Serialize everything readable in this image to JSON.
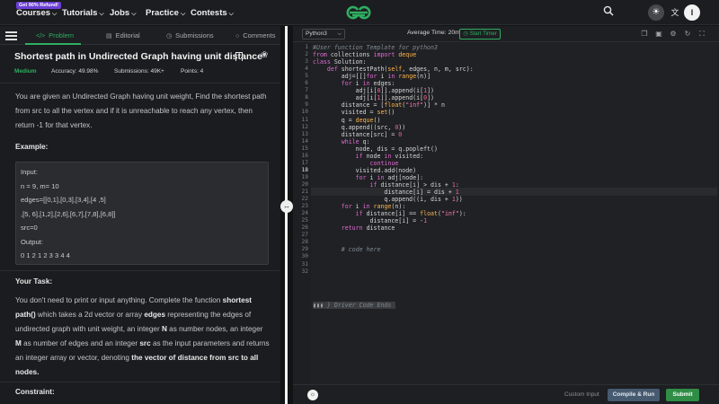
{
  "nav": {
    "promo": "Get 90% Refund!",
    "items": [
      "Courses",
      "Tutorials",
      "Jobs",
      "Practice",
      "Contests"
    ],
    "avatar_letter": "I"
  },
  "tabs": [
    "Problem",
    "Editorial",
    "Submissions",
    "Comments"
  ],
  "problem": {
    "title": "Shortest path in Undirected Graph having unit distance",
    "difficulty": "Medium",
    "accuracy": "Accuracy: 49.98%",
    "submissions": "Submissions: 49K+",
    "points": "Points: 4",
    "description": "You are given an Undirected Graph having unit weight, Find the shortest path from src to all the vertex and if it is unreachable to reach any vertex, then return -1 for that vertex.",
    "example_heading": "Example:",
    "example_lines": [
      "Input:",
      "n = 9, m= 10",
      "edges=[[0,1],[0,3],[3,4],[4 ,5]",
      ",[5, 6],[1,2],[2,6],[6,7],[7,8],[6,8]]",
      "src=0",
      "Output:",
      "0 1 2 1 2 3 3 4 4"
    ],
    "task_heading": "Your Task:",
    "task_intro": "You don't need to print or input anything. Complete the function ",
    "task_fn": "shortest path()",
    "task_mid1": " which takes a 2d vector or array ",
    "task_edges": "edges",
    "task_mid2": " representing the edges of undirected graph with unit weight, an integer ",
    "task_n": "N",
    "task_mid3": " as number nodes, an integer ",
    "task_m": "M",
    "task_mid4": " as number of edges and an integer ",
    "task_src": "src",
    "task_mid5": " as the input parameters and returns an integer array or vector, denoting ",
    "task_tail": "the vector of distance from src to all nodes.",
    "constraint_heading": "Constraint:"
  },
  "editor": {
    "language": "Python3",
    "avg_time": "Average Time: 20m",
    "timer_label": "Start Timer",
    "custom_input": "Custom Input",
    "compile_label": "Compile & Run",
    "submit_label": "Submit",
    "driver_code": "} Driver Code Ends",
    "code_lines": [
      "#User function Template for python3",
      "from collections import deque",
      "class Solution:",
      "    def shortestPath(self, edges, n, m, src):",
      "        adj=[[]for i in range(n)]",
      "        for i in edges:",
      "            adj[i[0]].append(i[1])",
      "            adj[i[1]].append(i[0])",
      "        distance = [float(\"inf\")] * n",
      "        visited = set()",
      "        q = deque()",
      "        q.append((src, 0))",
      "        distance[src] = 0",
      "        while q:",
      "            node, dis = q.popleft()",
      "            if node in visited:",
      "                continue",
      "            visited.add(node)",
      "            for i in adj[node]:",
      "                if distance[i] > dis + 1:",
      "                    distance[i] = dis + 1",
      "                    q.append((i, dis + 1))",
      "        for i in range(n):",
      "            if distance[i] == float(\"inf\"):",
      "                distance[i] = -1",
      "        return distance",
      "",
      "",
      "        # code here",
      "",
      "",
      ""
    ]
  },
  "colors": {
    "accent_green": "#2fae62",
    "submit_green": "#2f8d46",
    "compile_blue": "#465a70",
    "promo_purple": "#6b3fd6"
  }
}
